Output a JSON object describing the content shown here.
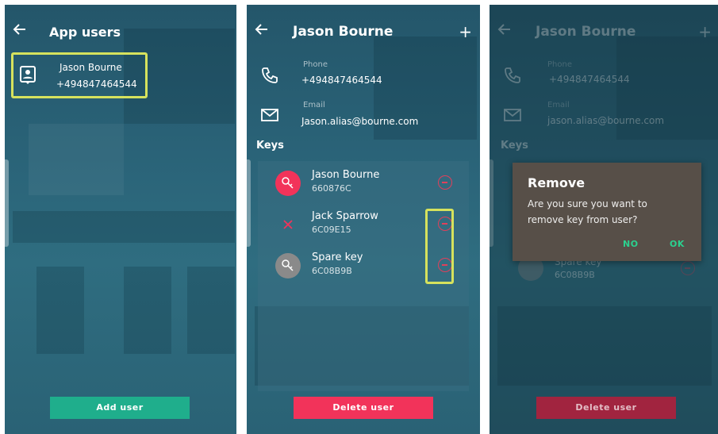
{
  "screen1": {
    "title": "App users",
    "user": {
      "name": "Jason Bourne",
      "phone": "+494847464544"
    },
    "add_label": "Add user"
  },
  "screen2": {
    "title": "Jason Bourne",
    "phone_label": "Phone",
    "phone": "+494847464544",
    "email_label": "Email",
    "email": "Jason.alias@bourne.com",
    "keys_heading": "Keys",
    "keys": [
      {
        "name": "Jason Bourne",
        "id": "660876C",
        "badge_color": "#f2335a"
      },
      {
        "name": "Jack Sparrow",
        "id": "6C09E15",
        "badge_color": "none"
      },
      {
        "name": "Spare key",
        "id": "6C08B9B",
        "badge_color": "#8a8a8a"
      }
    ],
    "delete_label": "Delete user"
  },
  "screen3": {
    "title": "Jason Bourne",
    "phone_label": "Phone",
    "phone": "+494847464544",
    "email_label": "Email",
    "email": "jason.alias@bourne.com",
    "keys_heading": "Keys",
    "partial_key": {
      "name": "Spare key",
      "id": "6C08B9B"
    },
    "dialog": {
      "title": "Remove",
      "message": "Are you sure you want to remove key from user?",
      "no": "NO",
      "ok": "OK"
    },
    "delete_label": "Delete user"
  },
  "colors": {
    "accent_green": "#1fae8c",
    "accent_red": "#f2335a",
    "highlight": "#d6e25d"
  }
}
